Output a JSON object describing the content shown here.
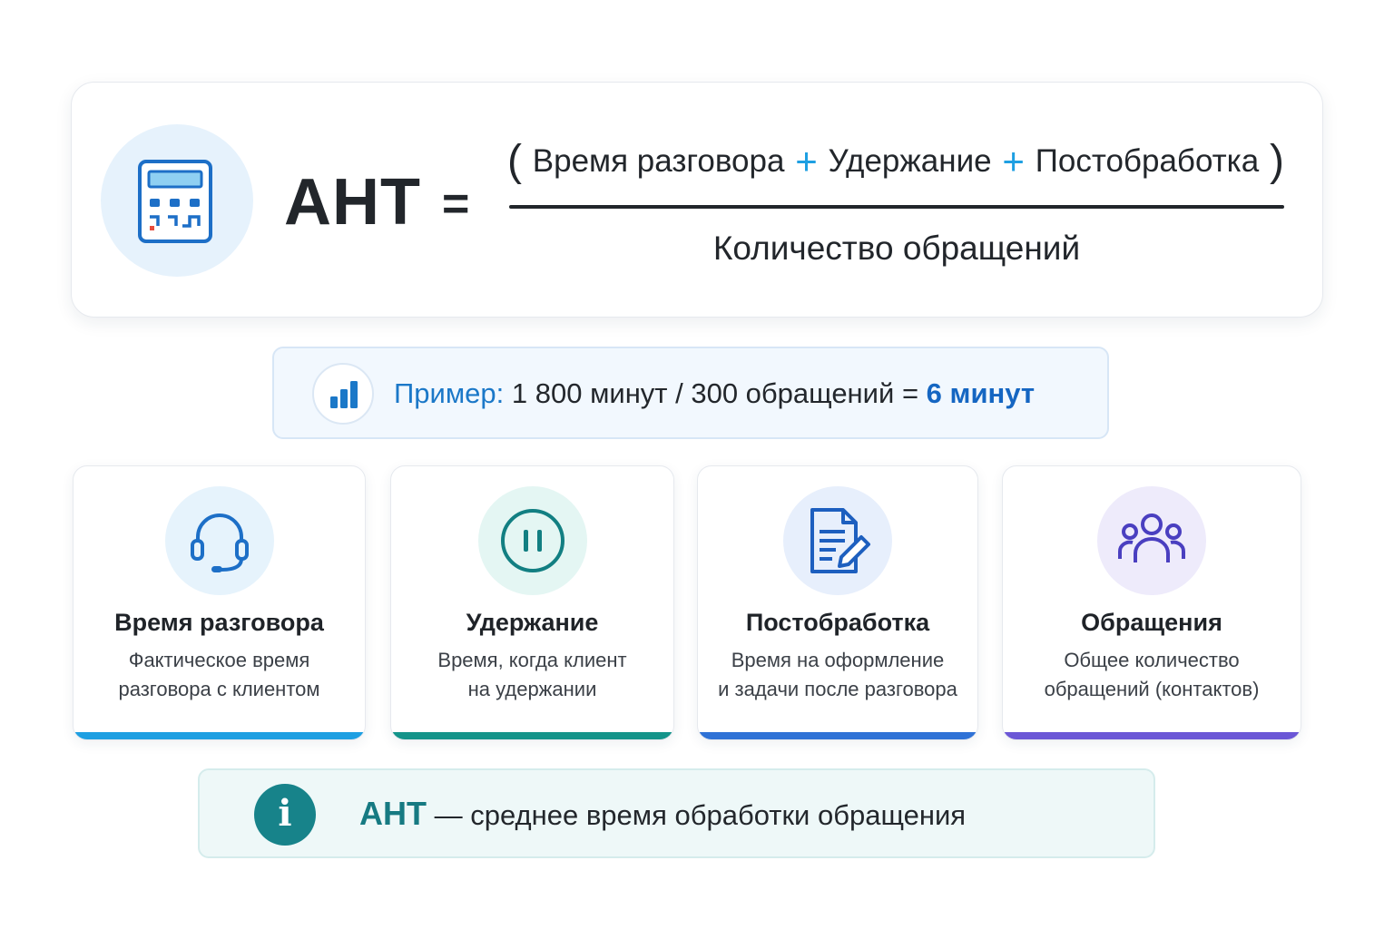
{
  "formula": {
    "lhs": "AHT",
    "equals": "=",
    "numerator": {
      "open_paren": "(",
      "term1": "Время разговора",
      "plus1": "+",
      "term2": "Удержание",
      "plus2": "+",
      "term3": "Постобработка",
      "close_paren": ")"
    },
    "denominator": "Количество обращений",
    "icon": "calculator-icon"
  },
  "example": {
    "icon": "bar-chart-icon",
    "label": "Пример:",
    "expression": "1 800 минут / 300 обращений",
    "equals": "=",
    "result": "6 минут"
  },
  "cards": [
    {
      "icon": "headset-icon",
      "title": "Время разговора",
      "desc_line1": "Фактическое время",
      "desc_line2": "разговора с клиентом",
      "color": "#1e9fe2",
      "circle_bg": "#e6f3fc"
    },
    {
      "icon": "pause-icon",
      "title": "Удержание",
      "desc_line1": "Время, когда клиент",
      "desc_line2": "на удержании",
      "color": "#14948a",
      "circle_bg": "#e4f6f3"
    },
    {
      "icon": "document-edit-icon",
      "title": "Постобработка",
      "desc_line1": "Время на оформление",
      "desc_line2": "и задачи после разговора",
      "color": "#2f72d6",
      "circle_bg": "#e7effc"
    },
    {
      "icon": "people-icon",
      "title": "Обращения",
      "desc_line1": "Общее количество",
      "desc_line2": "обращений (контактов)",
      "color": "#6b57d6",
      "circle_bg": "#eeebfb"
    }
  ],
  "info": {
    "icon": "info-icon",
    "icon_glyph": "i",
    "term": "AHT",
    "definition": "— среднее время обработки обращения"
  }
}
